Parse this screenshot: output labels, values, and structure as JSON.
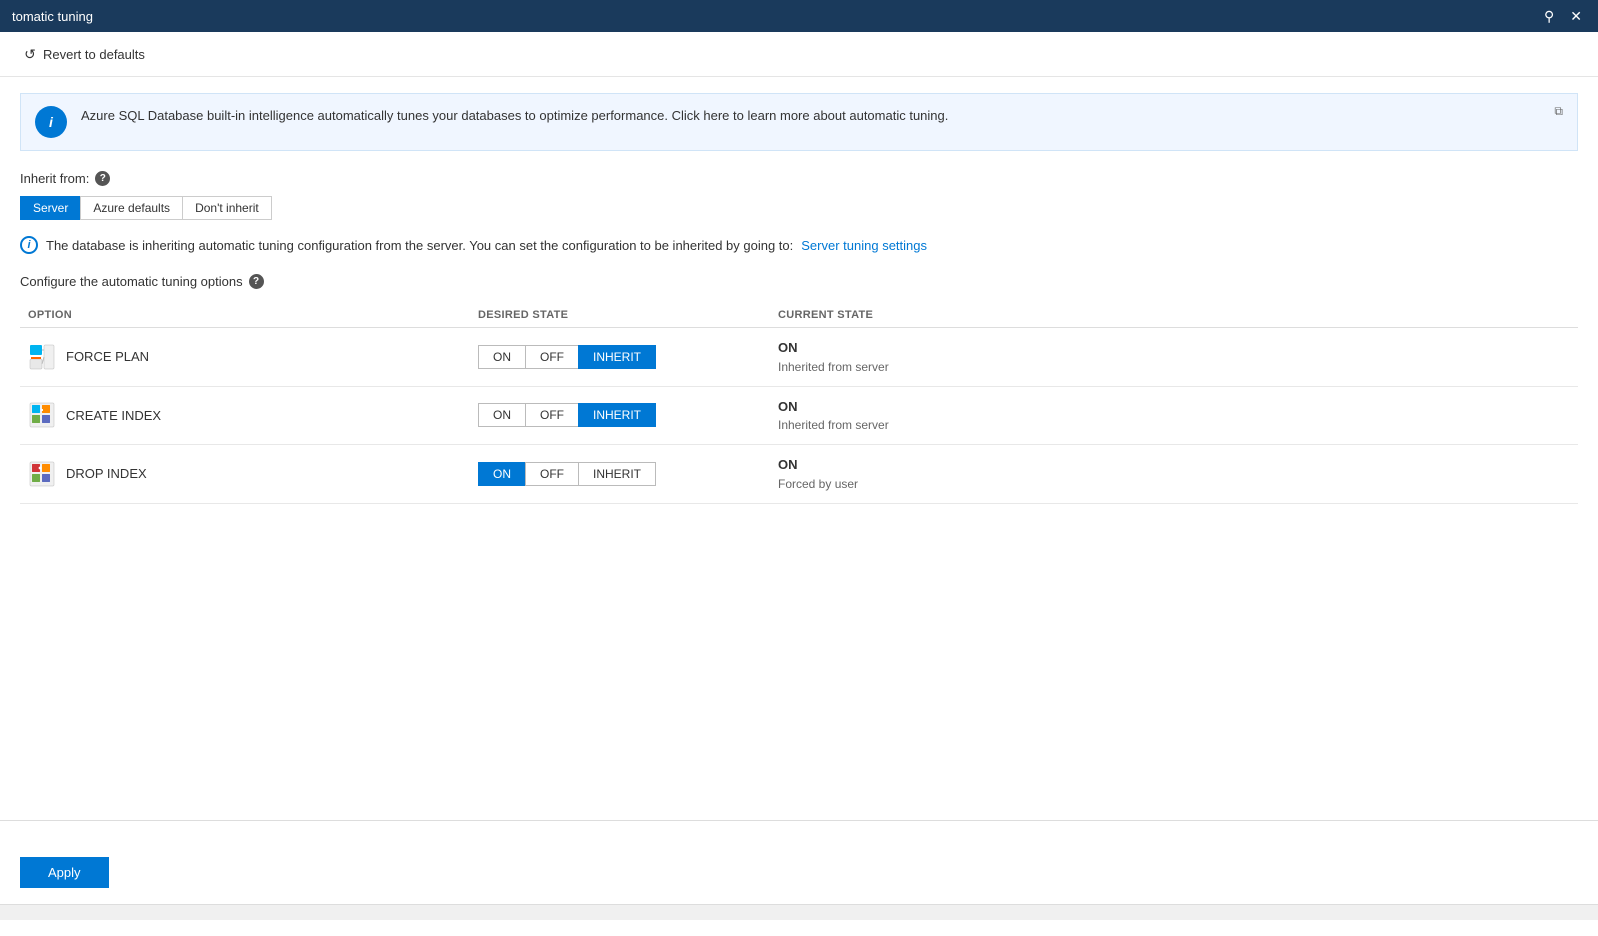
{
  "titleBar": {
    "title": "tomatic tuning",
    "pinIcon": "📌",
    "closeIcon": "✕"
  },
  "toolbar": {
    "revertLabel": "Revert to defaults"
  },
  "infoBanner": {
    "text": "Azure SQL Database built-in intelligence automatically tunes your databases to optimize performance. Click here to learn more about automatic tuning.",
    "externalLinkIcon": "⧉"
  },
  "inheritSection": {
    "label": "Inherit from:",
    "buttons": [
      "Server",
      "Azure defaults",
      "Don't inherit"
    ],
    "activeButton": "Server"
  },
  "inheritInfo": {
    "text": "The database is inheriting automatic tuning configuration from the server. You can set the configuration to be inherited by going to:",
    "linkText": "Server tuning settings"
  },
  "configSection": {
    "title": "Configure the automatic tuning options",
    "columns": {
      "option": "OPTION",
      "desiredState": "DESIRED STATE",
      "currentState": "CURRENT STATE"
    },
    "rows": [
      {
        "name": "FORCE PLAN",
        "iconType": "force-plan",
        "desiredState": {
          "buttons": [
            "ON",
            "OFF",
            "INHERIT"
          ],
          "active": "INHERIT",
          "activeClass": "active-inherit"
        },
        "currentState": {
          "value": "ON",
          "sub": "Inherited from server"
        }
      },
      {
        "name": "CREATE INDEX",
        "iconType": "create-index",
        "desiredState": {
          "buttons": [
            "ON",
            "OFF",
            "INHERIT"
          ],
          "active": "INHERIT",
          "activeClass": "active-inherit"
        },
        "currentState": {
          "value": "ON",
          "sub": "Inherited from server"
        }
      },
      {
        "name": "DROP INDEX",
        "iconType": "drop-index",
        "desiredState": {
          "buttons": [
            "ON",
            "OFF",
            "INHERIT"
          ],
          "active": "ON",
          "activeClass": "active-on"
        },
        "currentState": {
          "value": "ON",
          "sub": "Forced by user"
        }
      }
    ]
  },
  "footer": {
    "applyLabel": "Apply"
  }
}
